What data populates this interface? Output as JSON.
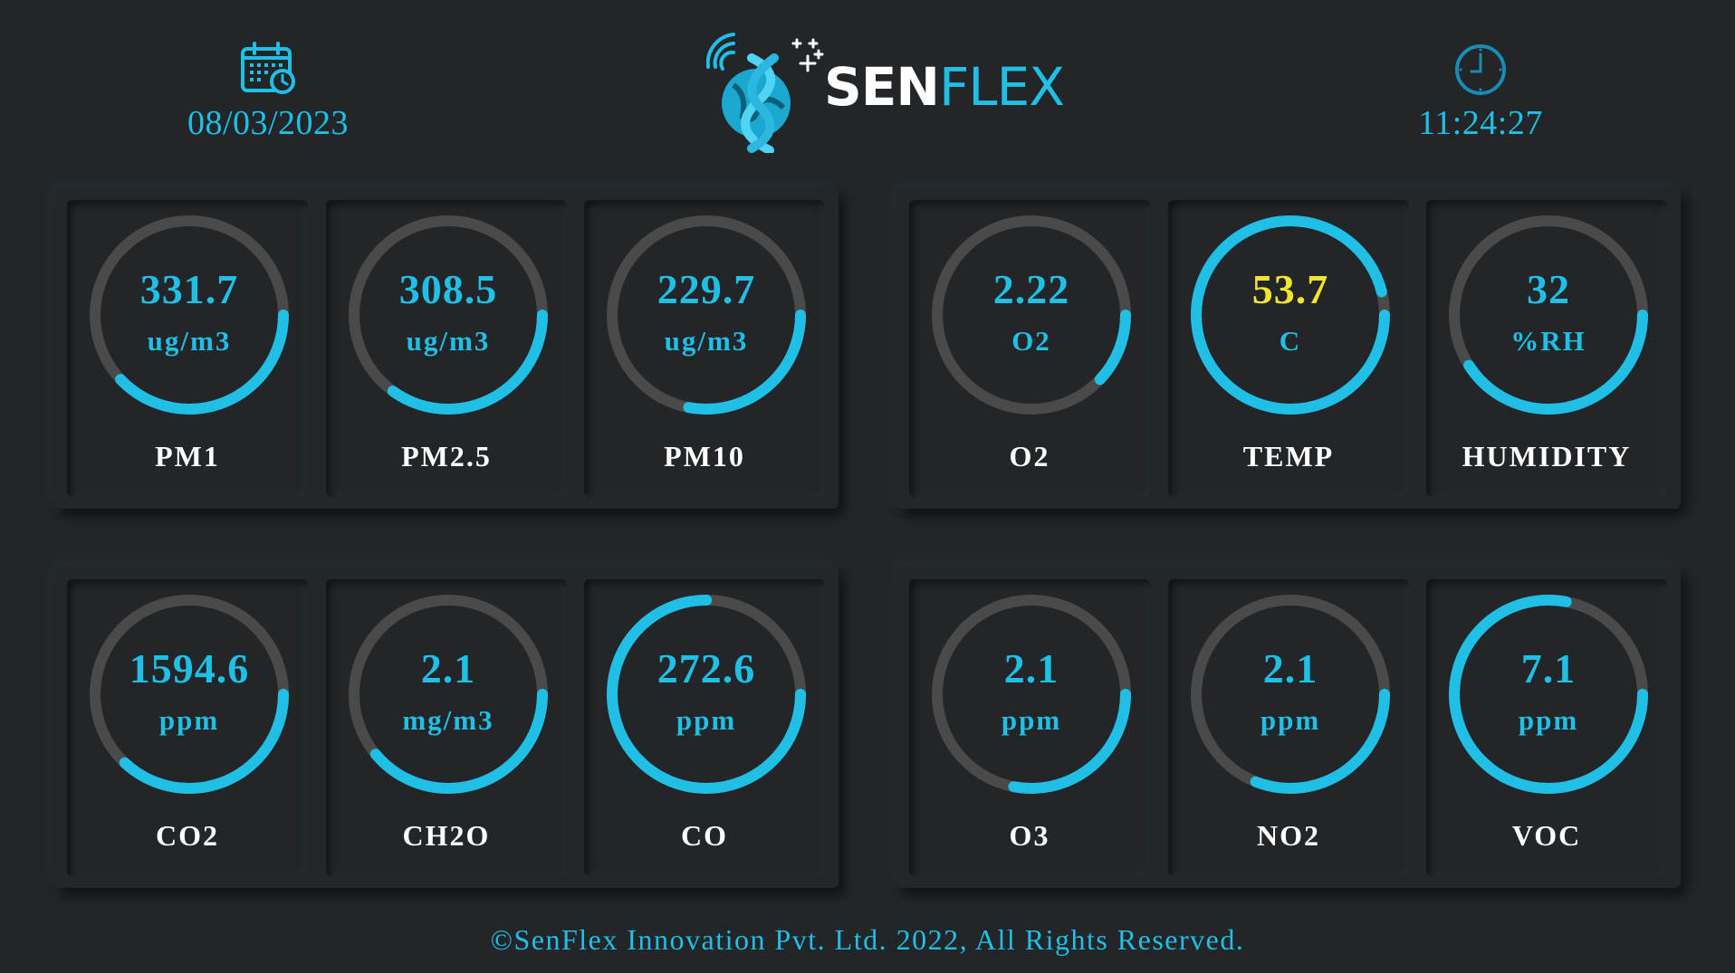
{
  "header": {
    "date": "08/03/2023",
    "time": "11:24:27",
    "logo_sen": "SEN",
    "logo_flex": "FLEX",
    "calendar_icon": "calendar-clock-icon",
    "clock_icon": "clock-icon"
  },
  "colors": {
    "accent": "#1fbfe6",
    "track": "#4a4a4a",
    "warning": "#f2e52c",
    "background": "#222629"
  },
  "panels": [
    {
      "gauges": [
        {
          "value": "331.7",
          "unit": "ug/m3",
          "label": "PM1",
          "fill": 0.38,
          "start": 0.25,
          "color": "accent"
        },
        {
          "value": "308.5",
          "unit": "ug/m3",
          "label": "PM2.5",
          "fill": 0.35,
          "start": 0.25,
          "color": "accent"
        },
        {
          "value": "229.7",
          "unit": "ug/m3",
          "label": "PM10",
          "fill": 0.28,
          "start": 0.25,
          "color": "accent"
        }
      ]
    },
    {
      "gauges": [
        {
          "value": "2.22",
          "unit": "O2",
          "label": "O2",
          "fill": 0.12,
          "start": 0.25,
          "color": "accent"
        },
        {
          "value": "53.7",
          "unit": "C",
          "label": "TEMP",
          "fill": 0.96,
          "start": 0.25,
          "color": "warning"
        },
        {
          "value": "32",
          "unit": "%RH",
          "label": "HUMIDITY",
          "fill": 0.41,
          "start": 0.25,
          "color": "accent"
        }
      ]
    },
    {
      "gauges": [
        {
          "value": "1594.6",
          "unit": "ppm",
          "label": "CO2",
          "fill": 0.37,
          "start": 0.25,
          "color": "accent"
        },
        {
          "value": "2.1",
          "unit": "mg/m3",
          "label": "CH2O",
          "fill": 0.39,
          "start": 0.25,
          "color": "accent"
        },
        {
          "value": "272.6",
          "unit": "ppm",
          "label": "CO",
          "fill": 0.75,
          "start": 0.25,
          "color": "accent"
        }
      ]
    },
    {
      "gauges": [
        {
          "value": "2.1",
          "unit": "ppm",
          "label": "O3",
          "fill": 0.28,
          "start": 0.25,
          "color": "accent"
        },
        {
          "value": "2.1",
          "unit": "ppm",
          "label": "NO2",
          "fill": 0.31,
          "start": 0.25,
          "color": "accent"
        },
        {
          "value": "7.1",
          "unit": "ppm",
          "label": "VOC",
          "fill": 0.78,
          "start": 0.25,
          "color": "accent"
        }
      ]
    }
  ],
  "footer": {
    "text": "©SenFlex Innovation Pvt. Ltd. 2022, All Rights Reserved."
  }
}
